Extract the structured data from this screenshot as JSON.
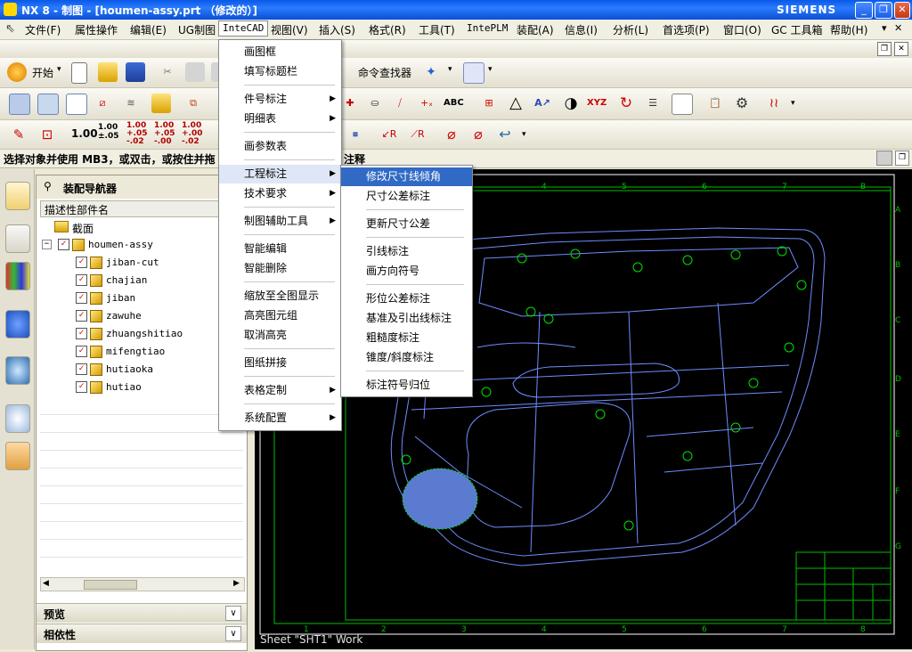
{
  "window": {
    "title": "NX 8 - 制图 - [houmen-assy.prt （修改的）]",
    "brand": "SIEMENS"
  },
  "menubar": {
    "items": [
      "文件(F)",
      "属性操作",
      "编辑(E)",
      "UG制图",
      "InteCAD",
      "视图(V)",
      "插入(S)",
      "格式(R)",
      "工具(T)",
      "IntePLM",
      "装配(A)",
      "信息(I)",
      "分析(L)",
      "首选项(P)",
      "窗口(O)",
      "GC 工具箱",
      "帮助(H)"
    ],
    "active": "InteCAD"
  },
  "toolbar": {
    "start_label": "开始",
    "command_finder": "命令查找器",
    "dims": [
      "1.00",
      "1.00 ±.05",
      "1.00 +.05 -.02",
      "1.00 +.05 -.00",
      "1.00 +.00 -.02"
    ],
    "abc": "ABC",
    "xyz": "XYZ"
  },
  "status": {
    "prompt": "选择对象并使用 MB3，或双击，或按住并拖",
    "prompt_tail": "注释"
  },
  "navigator": {
    "title": "装配导航器",
    "column": "描述性部件名",
    "section": "截面",
    "root": "houmen-assy",
    "parts": [
      "jiban-cut",
      "chajian",
      "jiban",
      "zawuhe",
      "zhuangshitiao",
      "mifengtiao",
      "hutiaoka",
      "hutiao"
    ],
    "panels": [
      "预览",
      "相依性"
    ]
  },
  "intecad_menu": {
    "groups": [
      [
        {
          "label": "画图框"
        },
        {
          "label": "填写标题栏"
        }
      ],
      [
        {
          "label": "件号标注",
          "sub": true
        },
        {
          "label": "明细表",
          "sub": true
        }
      ],
      [
        {
          "label": "画参数表"
        }
      ],
      [
        {
          "label": "工程标注",
          "sub": true,
          "active": true
        },
        {
          "label": "技术要求",
          "sub": true
        }
      ],
      [
        {
          "label": "制图辅助工具",
          "sub": true
        }
      ],
      [
        {
          "label": "智能编辑"
        },
        {
          "label": "智能删除"
        }
      ],
      [
        {
          "label": "缩放至全图显示"
        },
        {
          "label": "高亮图元组"
        },
        {
          "label": "取消高亮"
        }
      ],
      [
        {
          "label": "图纸拼接"
        }
      ],
      [
        {
          "label": "表格定制",
          "sub": true
        }
      ],
      [
        {
          "label": "系统配置",
          "sub": true
        }
      ]
    ]
  },
  "annotation_submenu": {
    "groups": [
      [
        {
          "label": "修改尺寸线倾角",
          "highlight": true
        },
        {
          "label": "尺寸公差标注"
        }
      ],
      [
        {
          "label": "更新尺寸公差"
        }
      ],
      [
        {
          "label": "引线标注"
        },
        {
          "label": "画方向符号"
        }
      ],
      [
        {
          "label": "形位公差标注"
        },
        {
          "label": "基准及引出线标注"
        },
        {
          "label": "粗糙度标注"
        },
        {
          "label": "锥度/斜度标注"
        }
      ],
      [
        {
          "label": "标注符号归位"
        }
      ]
    ]
  },
  "drawing": {
    "sheet_label": "Sheet \"SHT1\" Work",
    "col_numbers": [
      "1",
      "2",
      "3",
      "4",
      "5",
      "6",
      "7",
      "8"
    ],
    "top_numbers": [
      "4",
      "5",
      "6",
      "7",
      "8"
    ],
    "row_letters": [
      "A",
      "B",
      "C",
      "D",
      "E",
      "F",
      "G"
    ],
    "corner_letter": "B",
    "colors": {
      "frame": "#ffffff",
      "border": "#00c000",
      "geometry": "#6f8cff",
      "markers": "#00e000",
      "fill": "#5a7bd0"
    }
  }
}
